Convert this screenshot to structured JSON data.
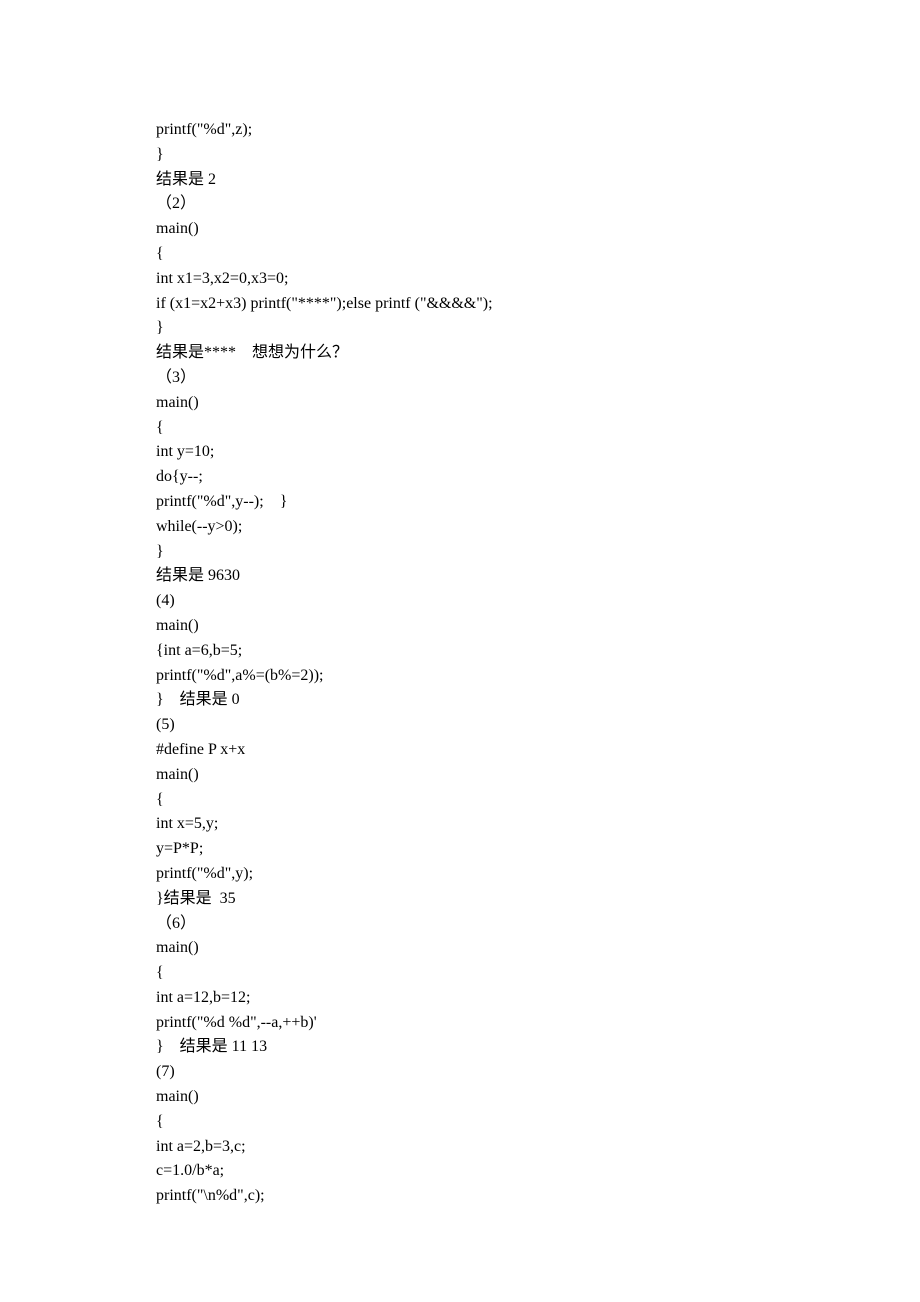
{
  "lines": [
    "printf(\"%d\",z);",
    "}",
    "结果是 2",
    "（2）",
    "main()",
    "{",
    "int x1=3,x2=0,x3=0;",
    "if (x1=x2+x3) printf(\"****\");else printf (\"&&&&\");",
    "}",
    "结果是****    想想为什么？",
    "（3）",
    "main()",
    "{",
    "int y=10;",
    "do{y--;",
    "printf(\"%d\",y--);    }",
    "while(--y>0);",
    "}",
    "结果是 9630",
    "(4)",
    "main()",
    "{int a=6,b=5;",
    "printf(\"%d\",a%=(b%=2));",
    "}    结果是 0",
    "(5)",
    "#define P x+x",
    "main()",
    "{",
    "int x=5,y;",
    "y=P*P;",
    "printf(\"%d\",y);",
    "}结果是  35",
    "（6）",
    "main()",
    "{",
    "int a=12,b=12;",
    "printf(\"%d %d\",--a,++b)'",
    "}    结果是 11 13",
    "(7)",
    "main()",
    "{",
    "int a=2,b=3,c;",
    "c=1.0/b*a;",
    "printf(\"\\n%d\",c);"
  ]
}
